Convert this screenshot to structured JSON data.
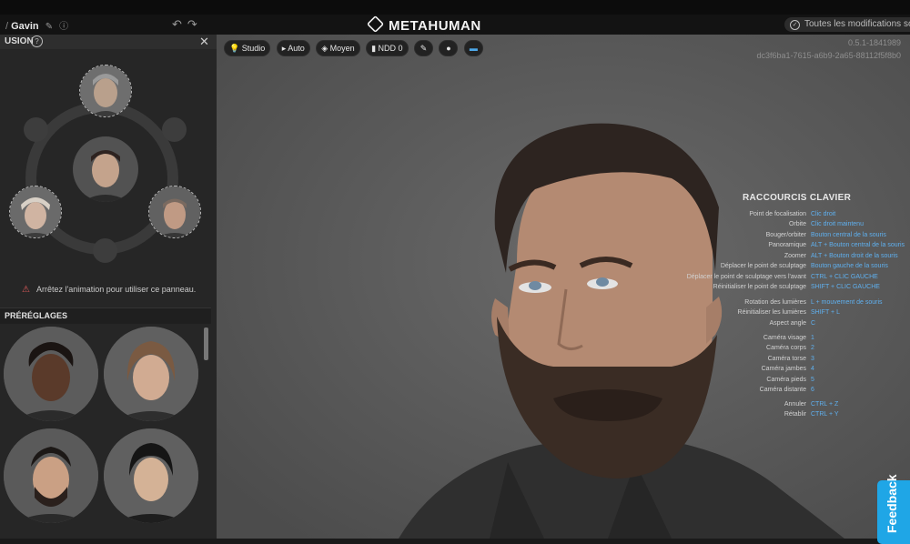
{
  "topbar": {
    "character_name": "Gavin",
    "brand": "METAHUMAN",
    "save_status": "Toutes les modifications sont"
  },
  "blend_panel": {
    "title": "USION",
    "warning": "Arrêtez l'animation pour utiliser ce panneau."
  },
  "presets": {
    "title": "PRÉRÉGLAGES"
  },
  "viewport": {
    "toolbar": {
      "studio": "Studio",
      "auto": "Auto",
      "quality": "Moyen",
      "lod": "NDD 0"
    },
    "version_line1": "0.5.1-1841989",
    "version_line2": "dc3f6ba1-7615-a6b9-2a65-88112f5f8b0",
    "shortcuts": {
      "title": "RACCOURCIS CLAVIER",
      "rows": [
        {
          "label": "Point de focalisation",
          "key": "Clic droit"
        },
        {
          "label": "Orbite",
          "key": "Clic droit maintenu"
        },
        {
          "label": "Bouger/orbiter",
          "key": "Bouton central de la souris"
        },
        {
          "label": "Panoramique",
          "key": "ALT + Bouton central de la souris"
        },
        {
          "label": "Zoomer",
          "key": "ALT + Bouton droit de la souris"
        },
        {
          "label": "Déplacer le point de sculptage",
          "key": "Bouton gauche de la souris"
        },
        {
          "label": "Déplacer le point de sculptage vers l'avant",
          "key": "CTRL + CLIC GAUCHE"
        },
        {
          "label": "Réinitialiser le point de sculptage",
          "key": "SHIFT + CLIC GAUCHE"
        },
        {
          "label": "Rotation des lumières",
          "key": "L + mouvement de souris"
        },
        {
          "label": "Réinitialiser les lumières",
          "key": "SHIFT + L"
        },
        {
          "label": "Aspect angle",
          "key": "C"
        },
        {
          "label": "Caméra visage",
          "key": "1"
        },
        {
          "label": "Caméra corps",
          "key": "2"
        },
        {
          "label": "Caméra torse",
          "key": "3"
        },
        {
          "label": "Caméra jambes",
          "key": "4"
        },
        {
          "label": "Caméra pieds",
          "key": "5"
        },
        {
          "label": "Caméra distante",
          "key": "6"
        },
        {
          "label": "Annuler",
          "key": "CTRL + Z"
        },
        {
          "label": "Rétablir",
          "key": "CTRL + Y"
        }
      ]
    },
    "feedback_label": "Feedback"
  },
  "colors": {
    "accent": "#1fa6e6",
    "link": "#5fb0ef",
    "warning": "#e05b5b"
  }
}
